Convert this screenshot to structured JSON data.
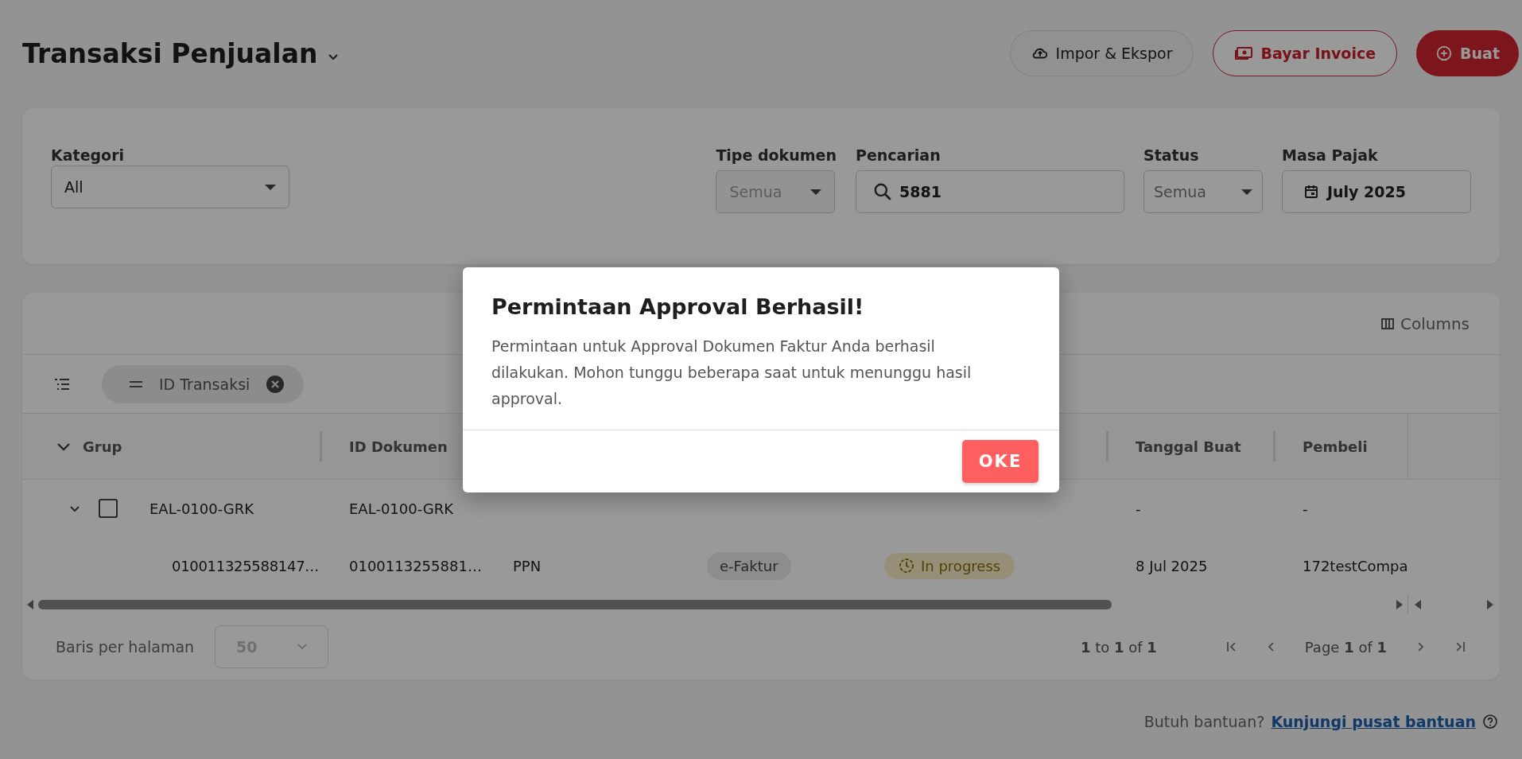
{
  "page": {
    "title": "Transaksi Penjualan",
    "actions": [
      {
        "kind": "import",
        "label": "Impor & Ekspor"
      },
      {
        "kind": "pay",
        "label": "Bayar Invoice"
      },
      {
        "kind": "create",
        "label": "Buat"
      }
    ]
  },
  "filters": {
    "kategori": {
      "label": "Kategori",
      "value": "All"
    },
    "tipe_dokumen": {
      "label": "Tipe dokumen",
      "value": "Semua",
      "disabled": true
    },
    "pencarian": {
      "label": "Pencarian",
      "value": "5881"
    },
    "status": {
      "label": "Status",
      "value": "Semua"
    },
    "masa_pajak": {
      "label": "Masa Pajak",
      "value": "July 2025"
    }
  },
  "table": {
    "columns_button": "Columns",
    "group_chip": "ID Transaksi",
    "columns": {
      "grup": "Grup",
      "id_dokumen": "ID Dokumen",
      "tanggal_buat": "Tanggal Buat",
      "pembeli": "Pembeli"
    },
    "rows": [
      {
        "kind": "group",
        "expanded": true,
        "checked": false,
        "grup": "EAL-0100-GRK",
        "id_dokumen": "EAL-0100-GRK",
        "tanggal_buat": "-",
        "pembeli": "-"
      },
      {
        "kind": "item",
        "grup": "010011325588147…",
        "id_dokumen": "0100113255881…",
        "column_3": "PPN",
        "column_4": "e-Faktur",
        "column_5": "In progress",
        "tanggal_buat": "8 Jul 2025",
        "pembeli": "172testCompa"
      }
    ],
    "footer": {
      "rows_label": "Baris per halaman",
      "rows_value": "50",
      "range": "**1** to **1** of **1**",
      "page": "Page **1** of **1**"
    }
  },
  "help": {
    "text": "Butuh bantuan?",
    "link": "Kunjungi pusat bantuan"
  },
  "dialog": {
    "title": "Permintaan Approval Berhasil!",
    "message": "Permintaan untuk Approval Dokumen Faktur Anda berhasil dilakukan. Mohon tunggu beberapa saat untuk menunggu hasil approval.",
    "button": "OKE"
  }
}
